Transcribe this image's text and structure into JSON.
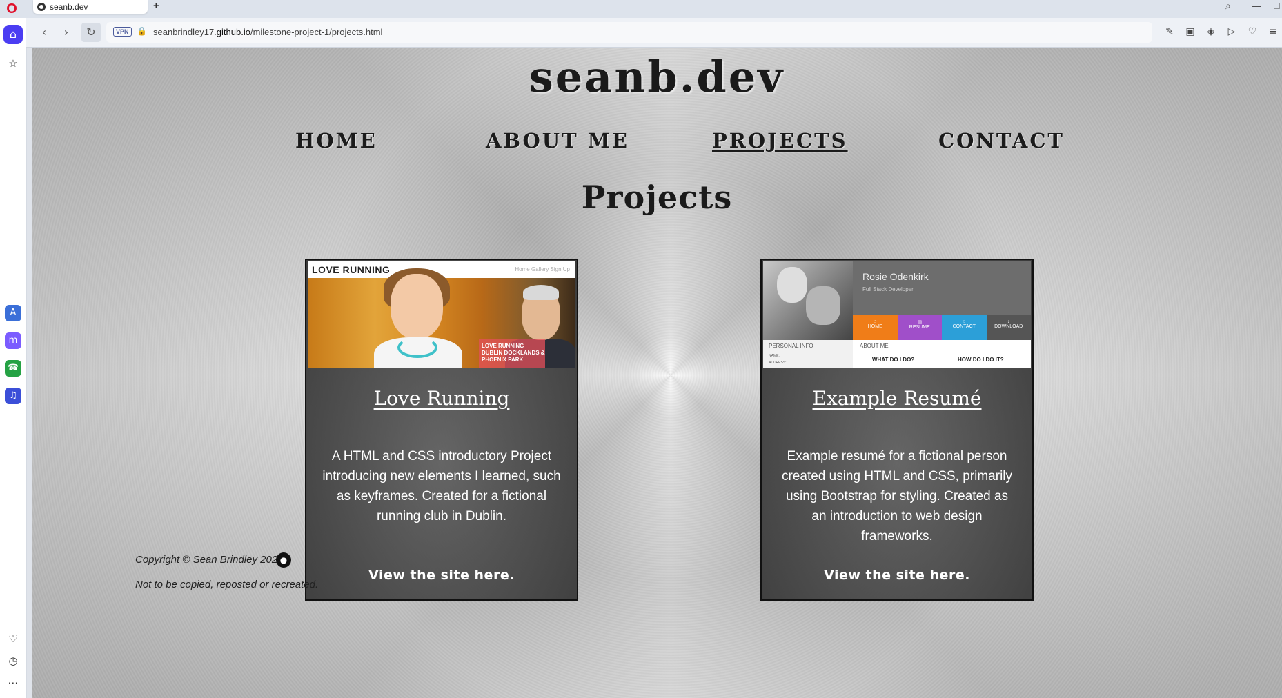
{
  "browser": {
    "tab_title": "seanb.dev",
    "new_tab": "+",
    "vpn_label": "VPN",
    "url_prefix": "seanbrindley17.",
    "url_domain": "github.io",
    "url_path": "/milestone-project-1/projects.html",
    "colors": {
      "sidebar_home": "#4b3df2",
      "opera_red": "#e0102b"
    }
  },
  "site": {
    "brand": "seanb.dev",
    "nav": [
      {
        "label": "HOME",
        "active": false
      },
      {
        "label": "ABOUT ME",
        "active": false
      },
      {
        "label": "PROJECTS",
        "active": true
      },
      {
        "label": "CONTACT",
        "active": false
      }
    ],
    "heading": "Projects",
    "cards": [
      {
        "title": "Love Running",
        "description": "A HTML and CSS introductory Project introducing new elements I learned, such as keyframes. Created for a fictional running club in Dublin.",
        "link": "View the site here.",
        "thumb": {
          "site_title": "LOVE RUNNING",
          "menu": "Home   Gallery   Sign Up",
          "badge_lines": [
            "LOVE RUNNING",
            "DUBLIN DOCKLANDS &",
            "PHOENIX PARK"
          ]
        }
      },
      {
        "title": "Example Resumé",
        "description": "Example resumé for a fictional person created using HTML and CSS, primarily using Bootstrap for styling. Created as an introduction to web design frameworks.",
        "link": "View the site here.",
        "thumb": {
          "name": "Rosie Odenkirk",
          "role": "Full Stack Developer",
          "tiles": [
            "HOME",
            "RESUME",
            "CONTACT",
            "DOWNLOAD"
          ],
          "personal_info": "PERSONAL INFO",
          "about_me": "ABOUT ME",
          "what_do_i_do": "WHAT DO I DO?",
          "how_do_i_do_it": "HOW DO I DO IT?",
          "name_label": "NAME:",
          "address_label": "ADDRESS:"
        }
      }
    ],
    "footer": {
      "copyright": "Copyright © Sean Brindley 2024",
      "notice": "Not to be copied, reposted or recreated."
    }
  }
}
